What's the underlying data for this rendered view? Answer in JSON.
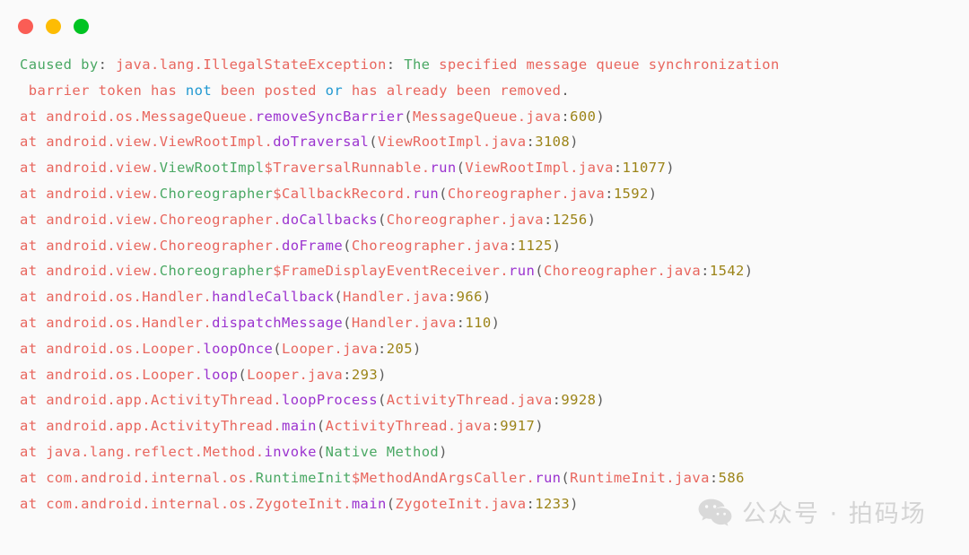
{
  "window": {
    "background_color": "#fafafa",
    "traffic_lights": [
      {
        "name": "close",
        "color": "#fa5d55"
      },
      {
        "name": "minimize",
        "color": "#fdbc04"
      },
      {
        "name": "maximize",
        "color": "#00c322"
      }
    ]
  },
  "colors": {
    "salmon": "#e8665e",
    "green": "#4aa864",
    "purple": "#9b33cf",
    "olive": "#9c8418",
    "gray": "#5c5c5c",
    "blue": "#2098d1",
    "watermark": "#d4d4d4"
  },
  "code": {
    "language": "java-stacktrace",
    "raw_text": "Caused by: java.lang.IllegalStateException: The specified message queue synchronization\n barrier token has not been posted or has already been removed.\nat android.os.MessageQueue.removeSyncBarrier(MessageQueue.java:600)\nat android.view.ViewRootImpl.doTraversal(ViewRootImpl.java:3108)\nat android.view.ViewRootImpl$TraversalRunnable.run(ViewRootImpl.java:11077)\nat android.view.Choreographer$CallbackRecord.run(Choreographer.java:1592)\nat android.view.Choreographer.doCallbacks(Choreographer.java:1256)\nat android.view.Choreographer.doFrame(Choreographer.java:1125)\nat android.view.Choreographer$FrameDisplayEventReceiver.run(Choreographer.java:1542)\nat android.os.Handler.handleCallback(Handler.java:966)\nat android.os.Handler.dispatchMessage(Handler.java:110)\nat android.os.Looper.loopOnce(Looper.java:205)\nat android.os.Looper.loop(Looper.java:293)\nat android.app.ActivityThread.loopProcess(ActivityThread.java:9928)\nat android.app.ActivityThread.main(ActivityThread.java:9917)\nat java.lang.reflect.Method.invoke(Native Method)\nat com.android.internal.os.RuntimeInit$MethodAndArgsCaller.run(RuntimeInit.java:586\nat com.android.internal.os.ZygoteInit.main(ZygoteInit.java:1233)",
    "lines": [
      {
        "id": "line-caused-by",
        "tokens": [
          {
            "text": "Caused by",
            "color": "green"
          },
          {
            "text": ": ",
            "color": "gray"
          },
          {
            "text": "java.lang.IllegalStateException",
            "color": "salmon"
          },
          {
            "text": ": ",
            "color": "gray"
          },
          {
            "text": "The",
            "color": "green"
          },
          {
            "text": " specified message queue synchronization",
            "color": "salmon"
          }
        ]
      },
      {
        "id": "line-message-cont",
        "tokens": [
          {
            "text": " barrier token has ",
            "color": "salmon"
          },
          {
            "text": "not",
            "color": "blue"
          },
          {
            "text": " been posted ",
            "color": "salmon"
          },
          {
            "text": "or",
            "color": "blue"
          },
          {
            "text": " has already been removed",
            "color": "salmon"
          },
          {
            "text": ".",
            "color": "gray"
          }
        ]
      },
      {
        "id": "frame-1",
        "tokens": [
          {
            "text": "at ",
            "color": "salmon"
          },
          {
            "text": "android.os.MessageQueue.",
            "color": "salmon"
          },
          {
            "text": "removeSyncBarrier",
            "color": "purple"
          },
          {
            "text": "(",
            "color": "gray"
          },
          {
            "text": "MessageQueue.java",
            "color": "salmon"
          },
          {
            "text": ":",
            "color": "gray"
          },
          {
            "text": "600",
            "color": "olive"
          },
          {
            "text": ")",
            "color": "gray"
          }
        ]
      },
      {
        "id": "frame-2",
        "tokens": [
          {
            "text": "at ",
            "color": "salmon"
          },
          {
            "text": "android.view.ViewRootImpl.",
            "color": "salmon"
          },
          {
            "text": "doTraversal",
            "color": "purple"
          },
          {
            "text": "(",
            "color": "gray"
          },
          {
            "text": "ViewRootImpl.java",
            "color": "salmon"
          },
          {
            "text": ":",
            "color": "gray"
          },
          {
            "text": "3108",
            "color": "olive"
          },
          {
            "text": ")",
            "color": "gray"
          }
        ]
      },
      {
        "id": "frame-3",
        "tokens": [
          {
            "text": "at ",
            "color": "salmon"
          },
          {
            "text": "android.view.",
            "color": "salmon"
          },
          {
            "text": "ViewRootImpl",
            "color": "green"
          },
          {
            "text": "$TraversalRunnable.",
            "color": "salmon"
          },
          {
            "text": "run",
            "color": "purple"
          },
          {
            "text": "(",
            "color": "gray"
          },
          {
            "text": "ViewRootImpl.java",
            "color": "salmon"
          },
          {
            "text": ":",
            "color": "gray"
          },
          {
            "text": "11077",
            "color": "olive"
          },
          {
            "text": ")",
            "color": "gray"
          }
        ]
      },
      {
        "id": "frame-4",
        "tokens": [
          {
            "text": "at ",
            "color": "salmon"
          },
          {
            "text": "android.view.",
            "color": "salmon"
          },
          {
            "text": "Choreographer",
            "color": "green"
          },
          {
            "text": "$CallbackRecord.",
            "color": "salmon"
          },
          {
            "text": "run",
            "color": "purple"
          },
          {
            "text": "(",
            "color": "gray"
          },
          {
            "text": "Choreographer.java",
            "color": "salmon"
          },
          {
            "text": ":",
            "color": "gray"
          },
          {
            "text": "1592",
            "color": "olive"
          },
          {
            "text": ")",
            "color": "gray"
          }
        ]
      },
      {
        "id": "frame-5",
        "tokens": [
          {
            "text": "at ",
            "color": "salmon"
          },
          {
            "text": "android.view.Choreographer.",
            "color": "salmon"
          },
          {
            "text": "doCallbacks",
            "color": "purple"
          },
          {
            "text": "(",
            "color": "gray"
          },
          {
            "text": "Choreographer.java",
            "color": "salmon"
          },
          {
            "text": ":",
            "color": "gray"
          },
          {
            "text": "1256",
            "color": "olive"
          },
          {
            "text": ")",
            "color": "gray"
          }
        ]
      },
      {
        "id": "frame-6",
        "tokens": [
          {
            "text": "at ",
            "color": "salmon"
          },
          {
            "text": "android.view.Choreographer.",
            "color": "salmon"
          },
          {
            "text": "doFrame",
            "color": "purple"
          },
          {
            "text": "(",
            "color": "gray"
          },
          {
            "text": "Choreographer.java",
            "color": "salmon"
          },
          {
            "text": ":",
            "color": "gray"
          },
          {
            "text": "1125",
            "color": "olive"
          },
          {
            "text": ")",
            "color": "gray"
          }
        ]
      },
      {
        "id": "frame-7",
        "tokens": [
          {
            "text": "at ",
            "color": "salmon"
          },
          {
            "text": "android.view.",
            "color": "salmon"
          },
          {
            "text": "Choreographer",
            "color": "green"
          },
          {
            "text": "$FrameDisplayEventReceiver.",
            "color": "salmon"
          },
          {
            "text": "run",
            "color": "purple"
          },
          {
            "text": "(",
            "color": "gray"
          },
          {
            "text": "Choreographer.java",
            "color": "salmon"
          },
          {
            "text": ":",
            "color": "gray"
          },
          {
            "text": "1542",
            "color": "olive"
          },
          {
            "text": ")",
            "color": "gray"
          }
        ]
      },
      {
        "id": "frame-8",
        "tokens": [
          {
            "text": "at ",
            "color": "salmon"
          },
          {
            "text": "android.os.Handler.",
            "color": "salmon"
          },
          {
            "text": "handleCallback",
            "color": "purple"
          },
          {
            "text": "(",
            "color": "gray"
          },
          {
            "text": "Handler.java",
            "color": "salmon"
          },
          {
            "text": ":",
            "color": "gray"
          },
          {
            "text": "966",
            "color": "olive"
          },
          {
            "text": ")",
            "color": "gray"
          }
        ]
      },
      {
        "id": "frame-9",
        "tokens": [
          {
            "text": "at ",
            "color": "salmon"
          },
          {
            "text": "android.os.Handler.",
            "color": "salmon"
          },
          {
            "text": "dispatchMessage",
            "color": "purple"
          },
          {
            "text": "(",
            "color": "gray"
          },
          {
            "text": "Handler.java",
            "color": "salmon"
          },
          {
            "text": ":",
            "color": "gray"
          },
          {
            "text": "110",
            "color": "olive"
          },
          {
            "text": ")",
            "color": "gray"
          }
        ]
      },
      {
        "id": "frame-10",
        "tokens": [
          {
            "text": "at ",
            "color": "salmon"
          },
          {
            "text": "android.os.Looper.",
            "color": "salmon"
          },
          {
            "text": "loopOnce",
            "color": "purple"
          },
          {
            "text": "(",
            "color": "gray"
          },
          {
            "text": "Looper.java",
            "color": "salmon"
          },
          {
            "text": ":",
            "color": "gray"
          },
          {
            "text": "205",
            "color": "olive"
          },
          {
            "text": ")",
            "color": "gray"
          }
        ]
      },
      {
        "id": "frame-11",
        "tokens": [
          {
            "text": "at ",
            "color": "salmon"
          },
          {
            "text": "android.os.Looper.",
            "color": "salmon"
          },
          {
            "text": "loop",
            "color": "purple"
          },
          {
            "text": "(",
            "color": "gray"
          },
          {
            "text": "Looper.java",
            "color": "salmon"
          },
          {
            "text": ":",
            "color": "gray"
          },
          {
            "text": "293",
            "color": "olive"
          },
          {
            "text": ")",
            "color": "gray"
          }
        ]
      },
      {
        "id": "frame-12",
        "tokens": [
          {
            "text": "at ",
            "color": "salmon"
          },
          {
            "text": "android.app.ActivityThread.",
            "color": "salmon"
          },
          {
            "text": "loopProcess",
            "color": "purple"
          },
          {
            "text": "(",
            "color": "gray"
          },
          {
            "text": "ActivityThread.java",
            "color": "salmon"
          },
          {
            "text": ":",
            "color": "gray"
          },
          {
            "text": "9928",
            "color": "olive"
          },
          {
            "text": ")",
            "color": "gray"
          }
        ]
      },
      {
        "id": "frame-13",
        "tokens": [
          {
            "text": "at ",
            "color": "salmon"
          },
          {
            "text": "android.app.ActivityThread.",
            "color": "salmon"
          },
          {
            "text": "main",
            "color": "purple"
          },
          {
            "text": "(",
            "color": "gray"
          },
          {
            "text": "ActivityThread.java",
            "color": "salmon"
          },
          {
            "text": ":",
            "color": "gray"
          },
          {
            "text": "9917",
            "color": "olive"
          },
          {
            "text": ")",
            "color": "gray"
          }
        ]
      },
      {
        "id": "frame-14",
        "tokens": [
          {
            "text": "at ",
            "color": "salmon"
          },
          {
            "text": "java.lang.reflect.Method.",
            "color": "salmon"
          },
          {
            "text": "invoke",
            "color": "purple"
          },
          {
            "text": "(",
            "color": "gray"
          },
          {
            "text": "Native Method",
            "color": "green"
          },
          {
            "text": ")",
            "color": "gray"
          }
        ]
      },
      {
        "id": "frame-15",
        "tokens": [
          {
            "text": "at ",
            "color": "salmon"
          },
          {
            "text": "com.android.internal.os.",
            "color": "salmon"
          },
          {
            "text": "RuntimeInit",
            "color": "green"
          },
          {
            "text": "$MethodAndArgsCaller.",
            "color": "salmon"
          },
          {
            "text": "run",
            "color": "purple"
          },
          {
            "text": "(",
            "color": "gray"
          },
          {
            "text": "RuntimeInit.java",
            "color": "salmon"
          },
          {
            "text": ":",
            "color": "gray"
          },
          {
            "text": "586",
            "color": "olive"
          }
        ]
      },
      {
        "id": "frame-16",
        "tokens": [
          {
            "text": "at ",
            "color": "salmon"
          },
          {
            "text": "com.android.internal.os.ZygoteInit.",
            "color": "salmon"
          },
          {
            "text": "main",
            "color": "purple"
          },
          {
            "text": "(",
            "color": "gray"
          },
          {
            "text": "ZygoteInit.java",
            "color": "salmon"
          },
          {
            "text": ":",
            "color": "gray"
          },
          {
            "text": "1233",
            "color": "olive"
          },
          {
            "text": ")",
            "color": "gray"
          }
        ]
      }
    ]
  },
  "watermark": {
    "icon": "wechat-icon",
    "text": "公众号 · 拍码场"
  }
}
